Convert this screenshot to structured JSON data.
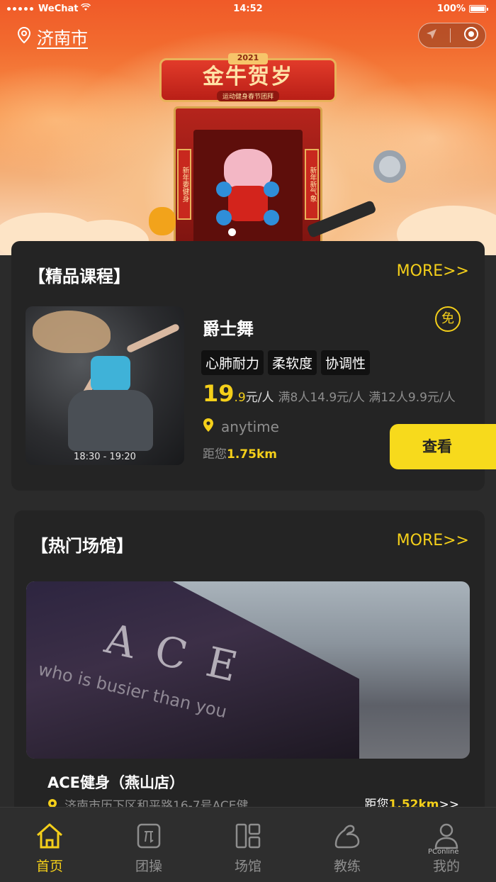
{
  "status_bar": {
    "carrier": "WeChat",
    "time": "14:52",
    "battery": "100%"
  },
  "header": {
    "city": "济南市"
  },
  "banner": {
    "year": "2021",
    "title": "金牛贺岁",
    "subtitle": "运动健身春节团拜",
    "couplet_left": "新年要健身",
    "couplet_right": "新年新气象",
    "active_slide": 1
  },
  "courses_section": {
    "title": "【精品课程】",
    "more_label": "MORE>>",
    "course": {
      "name": "爵士舞",
      "free_badge": "免",
      "time": "18:30 - 19:20",
      "tags": [
        "心肺耐力",
        "柔软度",
        "协调性"
      ],
      "price_int": "19",
      "price_dec": ".9",
      "price_unit": "元/人",
      "price_tiers": "满8人14.9元/人 满12人9.9元/人",
      "venue": "anytime",
      "distance_prefix": "距您",
      "distance": "1.75km",
      "view_label": "查看"
    }
  },
  "venues_section": {
    "title": "【热门场馆】",
    "more_label": "MORE>>",
    "venue": {
      "image_sign": "ACE",
      "image_slogan": "who is busier than you",
      "name": "ACE健身（燕山店）",
      "address": "济南市历下区和平路16-7号ACE健...",
      "distance_prefix": "距您",
      "distance": "1.52km",
      "distance_suffix": ">>"
    }
  },
  "tabbar": {
    "items": [
      {
        "label": "首页",
        "icon": "home-icon",
        "active": true
      },
      {
        "label": "团操",
        "icon": "group-class-icon",
        "active": false
      },
      {
        "label": "场馆",
        "icon": "venue-icon",
        "active": false
      },
      {
        "label": "教练",
        "icon": "coach-icon",
        "active": false
      },
      {
        "label": "我的",
        "icon": "profile-icon",
        "active": false
      }
    ]
  },
  "watermark": "PConline",
  "colors": {
    "accent": "#f4cf1a",
    "background": "#2b2b2b",
    "card": "#242424",
    "banner": "#f05a28"
  }
}
